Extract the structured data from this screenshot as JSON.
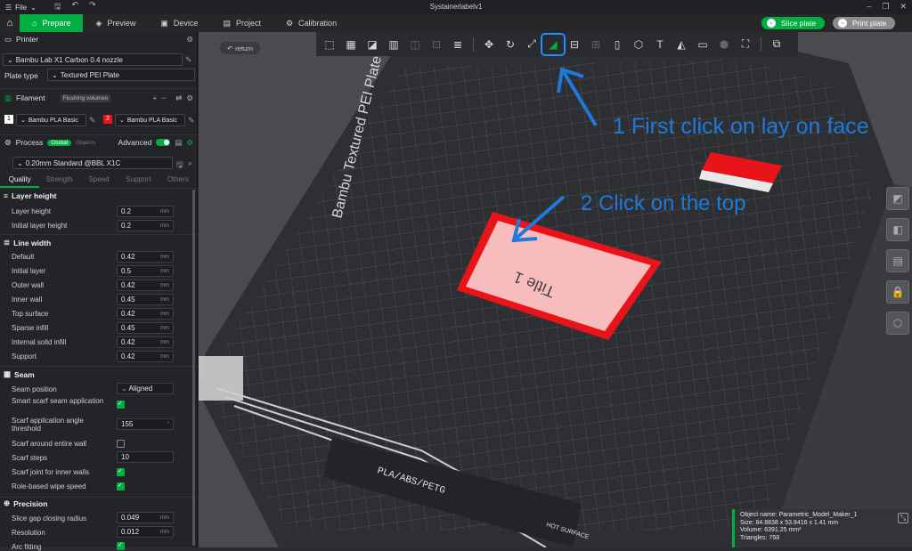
{
  "titlebar": {
    "file_label": "File",
    "title": "Systainerlabelv1"
  },
  "topbar": {
    "tabs": [
      {
        "label": "Prepare",
        "icon": "prepare-icon"
      },
      {
        "label": "Preview",
        "icon": "preview-icon"
      },
      {
        "label": "Device",
        "icon": "device-icon"
      },
      {
        "label": "Project",
        "icon": "project-icon"
      },
      {
        "label": "Calibration",
        "icon": "calibration-icon"
      }
    ],
    "slice_label": "Slice plate",
    "print_label": "Print plate"
  },
  "printer": {
    "section_label": "Printer",
    "model": "Bambu Lab X1 Carbon 0.4 nozzle",
    "plate_type_label": "Plate type",
    "plate_type": "Textured PEI Plate"
  },
  "filament": {
    "section_label": "Filament",
    "flushing_label": "Flushing volumes",
    "slots": [
      {
        "num": "1",
        "name": "Bambu PLA Basic",
        "color": "#ffffff"
      },
      {
        "num": "2",
        "name": "Bambu PLA Basic",
        "color": "#e8141a"
      }
    ]
  },
  "process": {
    "section_label": "Process",
    "global_label": "Global",
    "objects_label": "Objects",
    "advanced_label": "Advanced",
    "profile": "0.20mm Standard @BBL X1C",
    "tabs": [
      "Quality",
      "Strength",
      "Speed",
      "Support",
      "Others"
    ]
  },
  "groups": {
    "layer_height": "Layer height",
    "line_width": "Line width",
    "seam": "Seam",
    "precision": "Precision"
  },
  "params": {
    "layer_height": {
      "label": "Layer height",
      "value": "0.2",
      "unit": "mm"
    },
    "initial_layer_height": {
      "label": "Initial layer height",
      "value": "0.2",
      "unit": "mm"
    },
    "default": {
      "label": "Default",
      "value": "0.42",
      "unit": "mm"
    },
    "initial_layer": {
      "label": "Initial layer",
      "value": "0.5",
      "unit": "mm"
    },
    "outer_wall": {
      "label": "Outer wall",
      "value": "0.42",
      "unit": "mm"
    },
    "inner_wall": {
      "label": "Inner wall",
      "value": "0.45",
      "unit": "mm"
    },
    "top_surface": {
      "label": "Top surface",
      "value": "0.42",
      "unit": "mm"
    },
    "sparse_infill": {
      "label": "Sparse infill",
      "value": "0.45",
      "unit": "mm"
    },
    "internal_solid_infill": {
      "label": "Internal solid infill",
      "value": "0.42",
      "unit": "mm"
    },
    "support": {
      "label": "Support",
      "value": "0.42",
      "unit": "mm"
    },
    "seam_position": {
      "label": "Seam position",
      "value": "Aligned"
    },
    "smart_scarf": {
      "label": "Smart scarf seam application",
      "checked": true
    },
    "scarf_angle": {
      "label": "Scarf application angle threshold",
      "value": "155",
      "unit": "°"
    },
    "scarf_entire_wall": {
      "label": "Scarf around entire wall",
      "checked": false
    },
    "scarf_steps": {
      "label": "Scarf steps",
      "value": "10"
    },
    "scarf_inner_walls": {
      "label": "Scarf joint for inner walls",
      "checked": true
    },
    "role_wipe_speed": {
      "label": "Role-based wipe speed",
      "checked": true
    },
    "slice_gap": {
      "label": "Slice gap closing radius",
      "value": "0.049",
      "unit": "mm"
    },
    "resolution": {
      "label": "Resolution",
      "value": "0.012",
      "unit": "mm"
    },
    "arc_fitting": {
      "label": "Arc fitting",
      "checked": true
    }
  },
  "viewport": {
    "return_label": "return",
    "plate_text": "Bambu Textured PEI Plate",
    "plate_material_text": "PLA/ABS/PETG",
    "hot_surface_text": "HOT SURFACE",
    "object_text": "Title 1"
  },
  "annotations": {
    "step1": "1 First click on lay on face",
    "step2": "2 Click on the top"
  },
  "object_info": {
    "name": "Object name: Parametric_Model_Maker_1",
    "size": "Size: 84.8838 x 53.9416 x 1.41 mm",
    "volume": "Volume: 6391.25 mm³",
    "triangles": "Triangles: 758"
  },
  "colors": {
    "accent": "#00ae42",
    "annotation": "#1e7ad8",
    "object_red": "#e8141a"
  }
}
